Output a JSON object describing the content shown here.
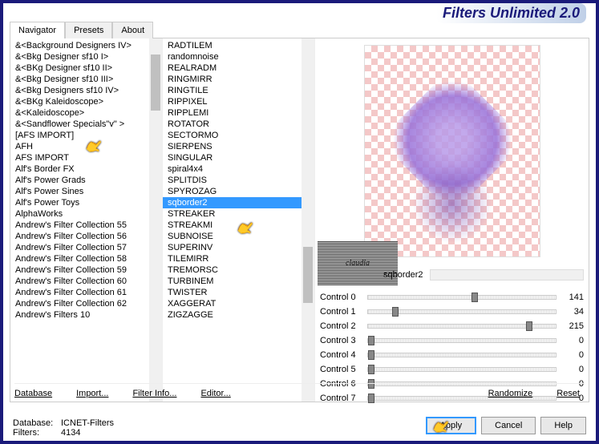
{
  "title": "Filters Unlimited 2.0",
  "tabs": [
    "Navigator",
    "Presets",
    "About"
  ],
  "active_tab": 0,
  "categories": [
    "&<Background Designers IV>",
    "&<Bkg Designer sf10 I>",
    "&<BKg Designer sf10 II>",
    "&<Bkg Designer sf10 III>",
    "&<Bkg Designers sf10 IV>",
    "&<BKg Kaleidoscope>",
    "&<Kaleidoscope>",
    "&<Sandflower Specials\"v\" >",
    "[AFS IMPORT]",
    "AFH",
    "AFS IMPORT",
    "Alf's Border FX",
    "Alf's Power Grads",
    "Alf's Power Sines",
    "Alf's Power Toys",
    "AlphaWorks",
    "Andrew's Filter Collection 55",
    "Andrew's Filter Collection 56",
    "Andrew's Filter Collection 57",
    "Andrew's Filter Collection 58",
    "Andrew's Filter Collection 59",
    "Andrew's Filter Collection 60",
    "Andrew's Filter Collection 61",
    "Andrew's Filter Collection 62",
    "Andrew's Filters 10"
  ],
  "selected_category_index": 8,
  "filters": [
    "RADTILEM",
    "randomnoise",
    "REALRADM",
    "RINGMIRR",
    "RINGTILE",
    "RIPPIXEL",
    "RIPPLEMI",
    "ROTATOR",
    "SECTORMO",
    "SIERPENS",
    "SINGULAR",
    "spiral4x4",
    "SPLITDIS",
    "SPYROZAG",
    "sqborder2",
    "STREAKER",
    "STREAKMI",
    "SUBNOISE",
    "SUPERINV",
    "TILEMIRR",
    "TREMORSC",
    "TURBINEM",
    "TWISTER",
    "XAGGERAT",
    "ZIGZAGGE"
  ],
  "selected_filter_index": 14,
  "selected_filter_name": "sqborder2",
  "watermark": "claudia",
  "controls": [
    {
      "label": "Control 0",
      "value": 141,
      "pct": 55
    },
    {
      "label": "Control 1",
      "value": 34,
      "pct": 13
    },
    {
      "label": "Control 2",
      "value": 215,
      "pct": 84
    },
    {
      "label": "Control 3",
      "value": 0,
      "pct": 0
    },
    {
      "label": "Control 4",
      "value": 0,
      "pct": 0
    },
    {
      "label": "Control 5",
      "value": 0,
      "pct": 0
    },
    {
      "label": "Control 6",
      "value": 0,
      "pct": 0
    },
    {
      "label": "Control 7",
      "value": 0,
      "pct": 0
    }
  ],
  "links": {
    "database": "Database",
    "import": "Import...",
    "filter_info": "Filter Info...",
    "editor": "Editor...",
    "randomize": "Randomize",
    "reset": "Reset"
  },
  "status": {
    "db_label": "Database:",
    "db_value": "ICNET-Filters",
    "filters_label": "Filters:",
    "filters_value": "4134"
  },
  "buttons": {
    "apply": "Apply",
    "cancel": "Cancel",
    "help": "Help"
  }
}
